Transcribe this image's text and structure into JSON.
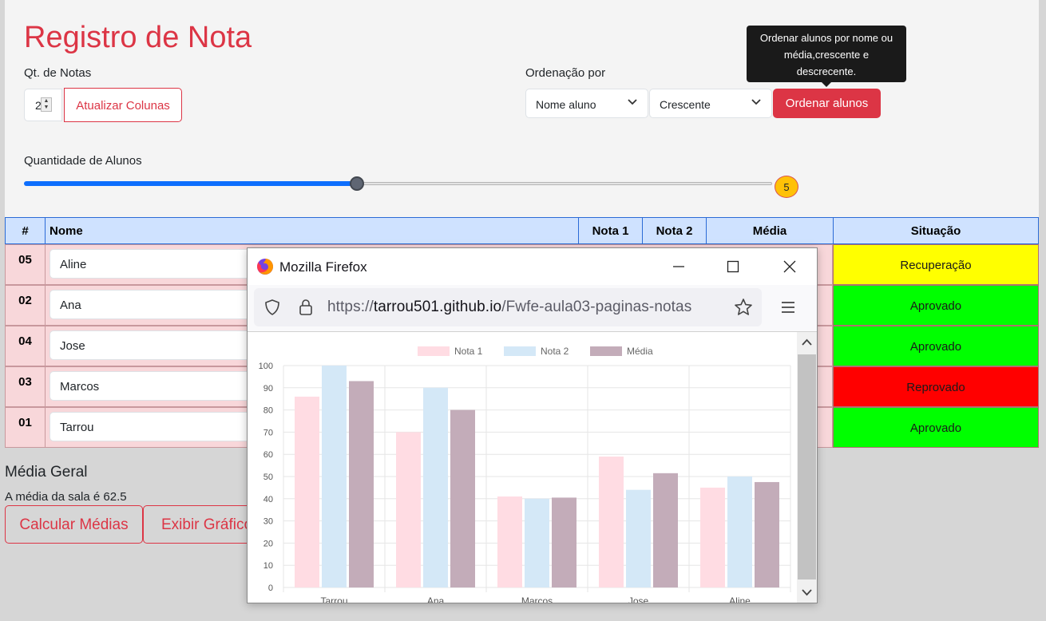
{
  "header": {
    "title": "Registro de Nota",
    "qt_notas_label": "Qt. de Notas",
    "qt_notas_value": "2",
    "atualizar_label": "Atualizar Colunas",
    "ordenacao_label": "Ordenação por",
    "sort_field_value": "Nome aluno",
    "sort_dir_value": "Crescente",
    "ordenar_label": "Ordenar alunos",
    "tooltip": "Ordenar alunos por nome ou média,crescente e descrecente.",
    "qtd_alunos_label": "Quantidade de Alunos",
    "qtd_alunos_value": "5",
    "qtd_alunos_fraction": 0.5
  },
  "table": {
    "headers": [
      "#",
      "Nome",
      "Nota 1",
      "Nota 2",
      "Média",
      "Situação"
    ],
    "rows": [
      {
        "id": "05",
        "nome": "Aline",
        "situacao": "Recuperação",
        "color": "#ffff00"
      },
      {
        "id": "02",
        "nome": "Ana",
        "situacao": "Aprovado",
        "color": "#00ff00"
      },
      {
        "id": "04",
        "nome": "Jose",
        "situacao": "Aprovado",
        "color": "#00ff00"
      },
      {
        "id": "03",
        "nome": "Marcos",
        "situacao": "Reprovado",
        "color": "#ff0000"
      },
      {
        "id": "01",
        "nome": "Tarrou",
        "situacao": "Aprovado",
        "color": "#00ff00"
      }
    ]
  },
  "summary": {
    "title": "Média Geral",
    "text": "A média da sala é 62.5",
    "calc_label": "Calcular Médias",
    "grafico_label": "Exibir Gráfico"
  },
  "firefox": {
    "title": "Mozilla Firefox",
    "url_prefix": "https://",
    "url_domain": "tarrou501.github.io",
    "url_path": "/Fwfe-aula03-paginas-notas"
  },
  "chart_data": {
    "type": "bar",
    "categories": [
      "Tarrou",
      "Ana",
      "Marcos",
      "Jose",
      "Aline"
    ],
    "series": [
      {
        "name": "Nota 1",
        "values": [
          86,
          70,
          41,
          59,
          45
        ],
        "color": "#ffdce3"
      },
      {
        "name": "Nota 2",
        "values": [
          100,
          90,
          40,
          44,
          50
        ],
        "color": "#d4e8f7"
      },
      {
        "name": "Média",
        "values": [
          93,
          80,
          40.5,
          51.5,
          47.5
        ],
        "color": "#c3acb9"
      }
    ],
    "ylim": [
      0,
      100
    ],
    "yticks": [
      0,
      10,
      20,
      30,
      40,
      50,
      60,
      70,
      80,
      90,
      100
    ],
    "legend": "top",
    "grid": true
  },
  "colors": {
    "accent": "#dc3545",
    "header_bg": "#cfe2ff",
    "row_bg": "#f8d7da"
  }
}
